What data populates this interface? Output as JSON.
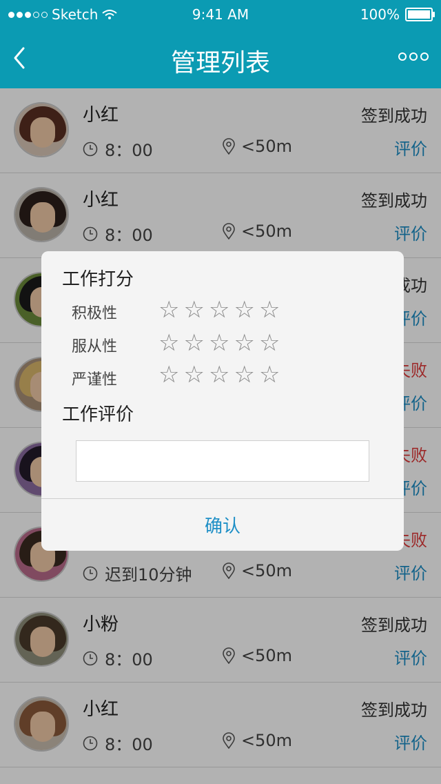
{
  "status_bar": {
    "carrier": "Sketch",
    "time": "9:41 AM",
    "battery": "100%"
  },
  "nav": {
    "title": "管理列表"
  },
  "list": {
    "items": [
      {
        "name": "小红",
        "time": "8：00",
        "distance": "<50m",
        "status": "签到成功",
        "status_type": "success",
        "rate_label": "评价"
      },
      {
        "name": "小红",
        "time": "8：00",
        "distance": "<50m",
        "status": "签到成功",
        "status_type": "success",
        "rate_label": "评价"
      },
      {
        "name": "",
        "time": "",
        "distance": "",
        "status": "成功",
        "status_type": "success",
        "rate_label": "评价"
      },
      {
        "name": "",
        "time": "",
        "distance": "",
        "status": "失败",
        "status_type": "fail",
        "rate_label": "评价"
      },
      {
        "name": "",
        "time": "",
        "distance": "",
        "status": "失败",
        "status_type": "fail",
        "rate_label": "评价"
      },
      {
        "name": "",
        "time": "迟到10分钟",
        "distance": "<50m",
        "status": "失败",
        "status_type": "fail",
        "rate_label": "评价"
      },
      {
        "name": "小粉",
        "time": "8：00",
        "distance": "<50m",
        "status": "签到成功",
        "status_type": "success",
        "rate_label": "评价"
      },
      {
        "name": "小红",
        "time": "8：00",
        "distance": "<50m",
        "status": "签到成功",
        "status_type": "success",
        "rate_label": "评价"
      }
    ]
  },
  "modal": {
    "title": "工作打分",
    "criteria": [
      {
        "label": "积极性",
        "rating": 0,
        "max": 5
      },
      {
        "label": "服从性",
        "rating": 0,
        "max": 5
      },
      {
        "label": "严谨性",
        "rating": 0,
        "max": 5
      }
    ],
    "comment_title": "工作评价",
    "comment_value": "",
    "confirm_label": "确认"
  },
  "colors": {
    "header": "#0b9bb3",
    "accent": "#1e8fc6",
    "fail": "#e03a3a"
  }
}
